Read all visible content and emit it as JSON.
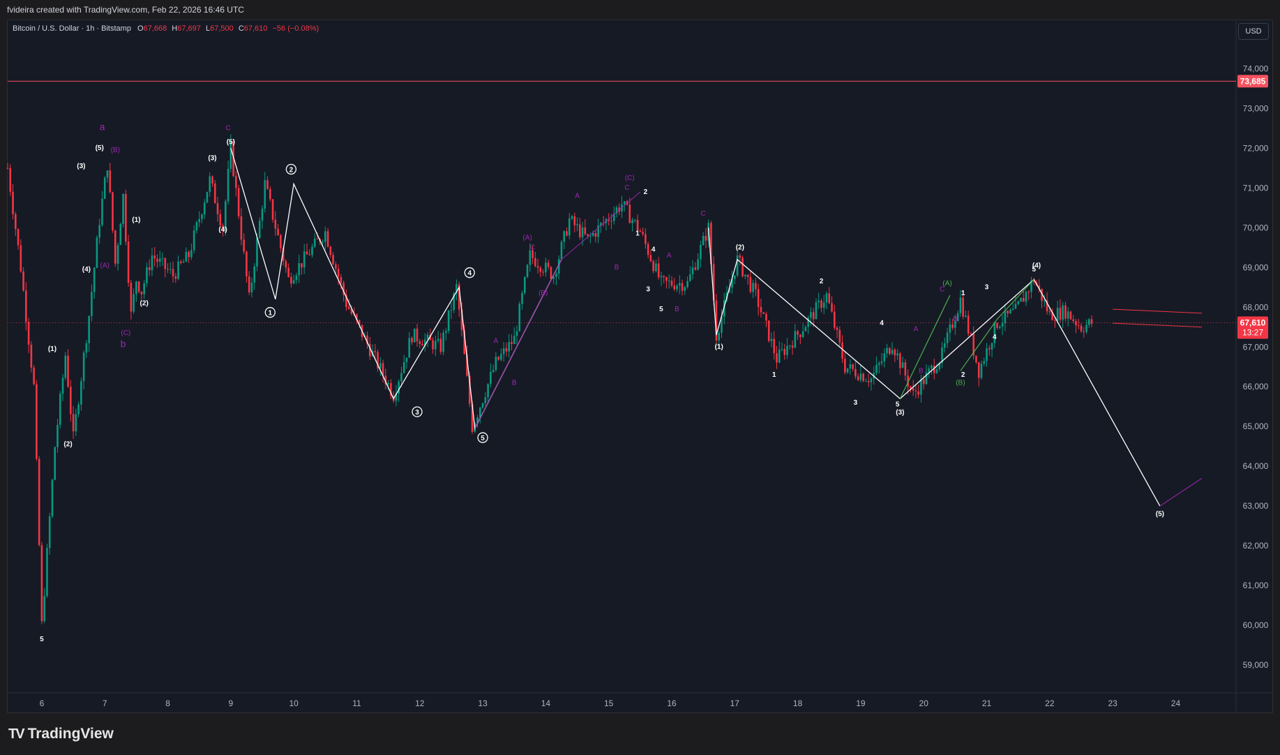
{
  "header": {
    "credit": "fvideira created with TradingView.com, Feb 22, 2026 16:46 UTC"
  },
  "legend": {
    "symbol": "Bitcoin / U.S. Dollar · 1h · Bitstamp",
    "o_label": "O",
    "o_value": "67,668",
    "h_label": "H",
    "h_value": "67,697",
    "l_label": "L",
    "l_value": "67,500",
    "c_label": "C",
    "c_value": "67,610",
    "change": "−56 (−0.08%)"
  },
  "currency_button": "USD",
  "footer": {
    "brand": "TradingView",
    "logo_icon": "tradingview-logo-icon"
  },
  "colors": {
    "up": "#089981",
    "down": "#f23645",
    "resistance": "#f7525f",
    "wave": "#ffffff",
    "purple": "#9c27b0",
    "green": "#4caf50",
    "background": "#161a25"
  },
  "chart_data": {
    "type": "candlestick",
    "title": "",
    "xlabel": "",
    "ylabel": "",
    "ylim": [
      58300,
      75200
    ],
    "xlim": [
      "2026-02-05T11:00",
      "2026-02-24T23:00"
    ],
    "x_ticks": [
      "6",
      "7",
      "8",
      "9",
      "10",
      "11",
      "12",
      "13",
      "14",
      "15",
      "16",
      "17",
      "18",
      "19",
      "20",
      "21",
      "22",
      "23",
      "24"
    ],
    "y_ticks": [
      "59,000",
      "60,000",
      "61,000",
      "62,000",
      "63,000",
      "64,000",
      "65,000",
      "66,000",
      "67,000",
      "68,000",
      "69,000",
      "70,000",
      "71,000",
      "72,000",
      "73,000",
      "74,000"
    ],
    "grid": false,
    "resistance_line": {
      "value": 73685,
      "label": "73,685"
    },
    "last_price": {
      "value": 67610,
      "label": "67,610",
      "countdown": "13:27"
    },
    "price_path": [
      [
        "2026-02-05T11:00",
        71500
      ],
      [
        "2026-02-05T16:00",
        69000
      ],
      [
        "2026-02-05T21:00",
        66000
      ],
      [
        "2026-02-06T00:00",
        60000
      ],
      [
        "2026-02-06T05:00",
        64500
      ],
      [
        "2026-02-06T09:00",
        66800
      ],
      [
        "2026-02-06T12:00",
        64700
      ],
      [
        "2026-02-06T18:00",
        67800
      ],
      [
        "2026-02-06T22:00",
        70200
      ],
      [
        "2026-02-07T01:00",
        71600
      ],
      [
        "2026-02-07T04:00",
        69100
      ],
      [
        "2026-02-07T07:00",
        70800
      ],
      [
        "2026-02-07T10:00",
        67800
      ],
      [
        "2026-02-07T12:00",
        68700
      ],
      [
        "2026-02-07T14:00",
        68400
      ],
      [
        "2026-02-07T18:00",
        69300
      ],
      [
        "2026-02-08T02:00",
        68800
      ],
      [
        "2026-02-08T08:00",
        69300
      ],
      [
        "2026-02-08T16:00",
        71200
      ],
      [
        "2026-02-08T21:00",
        70000
      ],
      [
        "2026-02-09T00:00",
        72000
      ],
      [
        "2026-02-09T07:00",
        68200
      ],
      [
        "2026-02-09T13:00",
        71100
      ],
      [
        "2026-02-09T22:00",
        68700
      ],
      [
        "2026-02-10T12:00",
        69900
      ],
      [
        "2026-02-10T20:00",
        68100
      ],
      [
        "2026-02-11T14:00",
        65800
      ],
      [
        "2026-02-11T21:00",
        67300
      ],
      [
        "2026-02-12T08:00",
        67000
      ],
      [
        "2026-02-12T14:00",
        68500
      ],
      [
        "2026-02-12T20:00",
        65000
      ],
      [
        "2026-02-13T05:00",
        66600
      ],
      [
        "2026-02-13T12:00",
        67200
      ],
      [
        "2026-02-13T18:00",
        69300
      ],
      [
        "2026-02-14T03:00",
        68800
      ],
      [
        "2026-02-14T09:00",
        70200
      ],
      [
        "2026-02-14T16:00",
        69700
      ],
      [
        "2026-02-15T05:00",
        70600
      ],
      [
        "2026-02-15T12:00",
        69900
      ],
      [
        "2026-02-15T20:00",
        68600
      ],
      [
        "2026-02-16T06:00",
        68600
      ],
      [
        "2026-02-16T14:00",
        70000
      ],
      [
        "2026-02-16T17:00",
        67300
      ],
      [
        "2026-02-17T01:00",
        69200
      ],
      [
        "2026-02-17T08:00",
        68300
      ],
      [
        "2026-02-17T16:00",
        66700
      ],
      [
        "2026-02-18T01:00",
        67400
      ],
      [
        "2026-02-18T11:00",
        68300
      ],
      [
        "2026-02-18T18:00",
        66500
      ],
      [
        "2026-02-19T04:00",
        66200
      ],
      [
        "2026-02-19T12:00",
        67100
      ],
      [
        "2026-02-19T20:00",
        65800
      ],
      [
        "2026-02-20T07:00",
        66800
      ],
      [
        "2026-02-20T14:00",
        68200
      ],
      [
        "2026-02-20T21:00",
        66400
      ],
      [
        "2026-02-21T04:00",
        67600
      ],
      [
        "2026-02-21T11:00",
        67900
      ],
      [
        "2026-02-21T18:00",
        68700
      ],
      [
        "2026-02-22T00:00",
        67800
      ],
      [
        "2026-02-22T06:00",
        67900
      ],
      [
        "2026-02-22T12:00",
        67500
      ],
      [
        "2026-02-22T16:00",
        67610
      ]
    ],
    "wave_count_main": [
      [
        "2026-02-09T00:00",
        72000
      ],
      [
        "2026-02-09T17:00",
        68200
      ],
      [
        "2026-02-10T00:00",
        71100
      ],
      [
        "2026-02-11T14:00",
        65700
      ],
      [
        "2026-02-12T15:00",
        68500
      ],
      [
        "2026-02-12T21:00",
        64950
      ],
      [
        "2026-02-14T06:00",
        69200
      ],
      [
        "2026-02-15T12:00",
        70900
      ]
    ],
    "wave_count_decline": [
      [
        "2026-02-16T14:00",
        70000
      ],
      [
        "2026-02-16T17:00",
        67300
      ],
      [
        "2026-02-17T01:00",
        69200
      ],
      [
        "2026-02-19T15:00",
        65700
      ],
      [
        "2026-02-21T18:00",
        68700
      ],
      [
        "2026-02-23T18:00",
        63000
      ]
    ],
    "green_subwaves": [
      [
        [
          "2026-02-19T15:00",
          65700
        ],
        [
          "2026-02-20T10:00",
          68300
        ]
      ],
      [
        [
          "2026-02-20T14:00",
          66400
        ],
        [
          "2026-02-21T04:00",
          67700
        ],
        [
          "2026-02-21T18:00",
          68700
        ]
      ]
    ],
    "projection_lines": [
      [
        [
          "2026-02-23T00:00",
          67950
        ],
        [
          "2026-02-24T10:00",
          67850
        ]
      ],
      [
        [
          "2026-02-23T00:00",
          67600
        ],
        [
          "2026-02-24T10:00",
          67500
        ]
      ],
      [
        [
          "2026-02-23T18:00",
          63000
        ],
        [
          "2026-02-24T10:00",
          63700
        ]
      ]
    ],
    "annotations": [
      {
        "text": "a",
        "x": "2026-02-06T23:00",
        "y": 72450,
        "color": "purple",
        "style": "letter"
      },
      {
        "text": "b",
        "x": "2026-02-07T07:00",
        "y": 67000,
        "color": "purple",
        "style": "letter"
      },
      {
        "text": "(5)",
        "x": "2026-02-06T22:00",
        "y": 71950,
        "color": "white",
        "style": "label"
      },
      {
        "text": "(B)",
        "x": "2026-02-07T04:00",
        "y": 71900,
        "color": "purple",
        "style": "label"
      },
      {
        "text": "(3)",
        "x": "2026-02-06T15:00",
        "y": 71500,
        "color": "white",
        "style": "label"
      },
      {
        "text": "(1)",
        "x": "2026-02-07T12:00",
        "y": 70150,
        "color": "white",
        "style": "label"
      },
      {
        "text": "(4)",
        "x": "2026-02-06T17:00",
        "y": 68900,
        "color": "white",
        "style": "label"
      },
      {
        "text": "(A)",
        "x": "2026-02-07T00:00",
        "y": 69000,
        "color": "purple",
        "style": "label"
      },
      {
        "text": "(2)",
        "x": "2026-02-07T15:00",
        "y": 68050,
        "color": "white",
        "style": "label"
      },
      {
        "text": "(C)",
        "x": "2026-02-07T08:00",
        "y": 67300,
        "color": "purple",
        "style": "label"
      },
      {
        "text": "(1)",
        "x": "2026-02-06T04:00",
        "y": 66900,
        "color": "white",
        "style": "label"
      },
      {
        "text": "(2)",
        "x": "2026-02-06T10:00",
        "y": 64500,
        "color": "white",
        "style": "label"
      },
      {
        "text": "5",
        "x": "2026-02-06T00:00",
        "y": 59600,
        "color": "white",
        "style": "label"
      },
      {
        "text": "(3)",
        "x": "2026-02-08T17:00",
        "y": 71700,
        "color": "white",
        "style": "label"
      },
      {
        "text": "(4)",
        "x": "2026-02-08T21:00",
        "y": 69900,
        "color": "white",
        "style": "label"
      },
      {
        "text": "C",
        "x": "2026-02-08T23:00",
        "y": 72450,
        "color": "purple",
        "style": "label"
      },
      {
        "text": "(5)",
        "x": "2026-02-09T00:00",
        "y": 72100,
        "color": "white",
        "style": "label"
      },
      {
        "text": "2",
        "x": "2026-02-09T23:00",
        "y": 71400,
        "color": "white",
        "style": "circled"
      },
      {
        "text": "1",
        "x": "2026-02-09T15:00",
        "y": 67800,
        "color": "white",
        "style": "circled"
      },
      {
        "text": "3",
        "x": "2026-02-11T23:00",
        "y": 65300,
        "color": "white",
        "style": "circled"
      },
      {
        "text": "4",
        "x": "2026-02-12T19:00",
        "y": 68800,
        "color": "white",
        "style": "circled"
      },
      {
        "text": "5",
        "x": "2026-02-13T00:00",
        "y": 64650,
        "color": "white",
        "style": "circled"
      },
      {
        "text": "A",
        "x": "2026-02-13T05:00",
        "y": 67100,
        "color": "purple",
        "style": "label"
      },
      {
        "text": "B",
        "x": "2026-02-13T12:00",
        "y": 66050,
        "color": "purple",
        "style": "label"
      },
      {
        "text": "(A)",
        "x": "2026-02-13T17:00",
        "y": 69700,
        "color": "purple",
        "style": "label"
      },
      {
        "text": "C",
        "x": "2026-02-13T19:00",
        "y": 69450,
        "color": "purple",
        "style": "label"
      },
      {
        "text": "(B)",
        "x": "2026-02-13T23:00",
        "y": 68300,
        "color": "purple",
        "style": "label"
      },
      {
        "text": "A",
        "x": "2026-02-14T12:00",
        "y": 70750,
        "color": "purple",
        "style": "label"
      },
      {
        "text": "(C)",
        "x": "2026-02-15T08:00",
        "y": 71200,
        "color": "purple",
        "style": "label"
      },
      {
        "text": "C",
        "x": "2026-02-15T07:00",
        "y": 70950,
        "color": "purple",
        "style": "label"
      },
      {
        "text": "2",
        "x": "2026-02-15T14:00",
        "y": 70850,
        "color": "white",
        "style": "label"
      },
      {
        "text": "B",
        "x": "2026-02-15T03:00",
        "y": 68950,
        "color": "purple",
        "style": "label"
      },
      {
        "text": "1",
        "x": "2026-02-15T11:00",
        "y": 69800,
        "color": "white",
        "style": "label"
      },
      {
        "text": "4",
        "x": "2026-02-15T17:00",
        "y": 69400,
        "color": "white",
        "style": "label"
      },
      {
        "text": "A",
        "x": "2026-02-15T23:00",
        "y": 69250,
        "color": "purple",
        "style": "label"
      },
      {
        "text": "3",
        "x": "2026-02-15T15:00",
        "y": 68400,
        "color": "white",
        "style": "label"
      },
      {
        "text": "5",
        "x": "2026-02-15T20:00",
        "y": 67900,
        "color": "white",
        "style": "label"
      },
      {
        "text": "B",
        "x": "2026-02-16T02:00",
        "y": 67900,
        "color": "purple",
        "style": "label"
      },
      {
        "text": "C",
        "x": "2026-02-16T12:00",
        "y": 70300,
        "color": "purple",
        "style": "label"
      },
      {
        "text": "(1)",
        "x": "2026-02-16T18:00",
        "y": 66950,
        "color": "white",
        "style": "label"
      },
      {
        "text": "(2)",
        "x": "2026-02-17T02:00",
        "y": 69450,
        "color": "white",
        "style": "label"
      },
      {
        "text": "1",
        "x": "2026-02-17T15:00",
        "y": 66250,
        "color": "white",
        "style": "label"
      },
      {
        "text": "2",
        "x": "2026-02-18T09:00",
        "y": 68600,
        "color": "white",
        "style": "label"
      },
      {
        "text": "3",
        "x": "2026-02-18T22:00",
        "y": 65550,
        "color": "white",
        "style": "label"
      },
      {
        "text": "4",
        "x": "2026-02-19T08:00",
        "y": 67550,
        "color": "white",
        "style": "label"
      },
      {
        "text": "5",
        "x": "2026-02-19T14:00",
        "y": 65500,
        "color": "white",
        "style": "label"
      },
      {
        "text": "(3)",
        "x": "2026-02-19T15:00",
        "y": 65300,
        "color": "white",
        "style": "label"
      },
      {
        "text": "A",
        "x": "2026-02-19T21:00",
        "y": 67400,
        "color": "purple",
        "style": "label"
      },
      {
        "text": "B",
        "x": "2026-02-19T23:00",
        "y": 66350,
        "color": "purple",
        "style": "label"
      },
      {
        "text": "(A)",
        "x": "2026-02-20T09:00",
        "y": 68550,
        "color": "green",
        "style": "label"
      },
      {
        "text": "C",
        "x": "2026-02-20T07:00",
        "y": 68400,
        "color": "purple",
        "style": "label"
      },
      {
        "text": "1",
        "x": "2026-02-20T15:00",
        "y": 68300,
        "color": "white",
        "style": "label"
      },
      {
        "text": "B",
        "x": "2026-02-20T12:00",
        "y": 67650,
        "color": "purple",
        "style": "label"
      },
      {
        "text": "(B)",
        "x": "2026-02-20T14:00",
        "y": 66050,
        "color": "green",
        "style": "label"
      },
      {
        "text": "2",
        "x": "2026-02-20T15:00",
        "y": 66250,
        "color": "white",
        "style": "label"
      },
      {
        "text": "3",
        "x": "2026-02-21T00:00",
        "y": 68450,
        "color": "white",
        "style": "label"
      },
      {
        "text": "4",
        "x": "2026-02-21T03:00",
        "y": 67200,
        "color": "white",
        "style": "label"
      },
      {
        "text": "(4)",
        "x": "2026-02-21T19:00",
        "y": 69000,
        "color": "white",
        "style": "label"
      },
      {
        "text": "5",
        "x": "2026-02-21T18:00",
        "y": 68900,
        "color": "white",
        "style": "label"
      },
      {
        "text": "(5)",
        "x": "2026-02-23T18:00",
        "y": 62750,
        "color": "white",
        "style": "label"
      }
    ]
  }
}
